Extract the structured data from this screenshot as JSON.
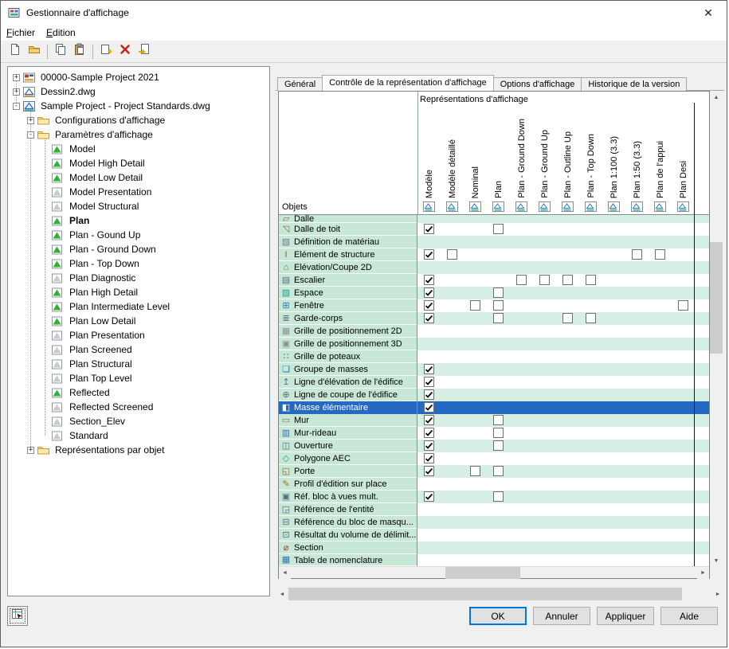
{
  "window": {
    "title": "Gestionnaire d'affichage",
    "close_glyph": "✕"
  },
  "menu": {
    "items": [
      "Fichier",
      "Edition"
    ]
  },
  "toolbar": {
    "buttons": [
      {
        "name": "new-button",
        "icon": "new-file-icon"
      },
      {
        "name": "open-button",
        "icon": "open-folder-icon"
      },
      {
        "name": "copy-button",
        "icon": "copy-icon"
      },
      {
        "name": "paste-button",
        "icon": "paste-icon"
      },
      {
        "name": "new-display-item-button",
        "icon": "new-item-icon"
      },
      {
        "name": "delete-button",
        "icon": "delete-red-x-icon"
      },
      {
        "name": "purge-button",
        "icon": "page-arrow-icon"
      }
    ]
  },
  "tree": {
    "items": [
      {
        "label": "00000-Sample Project 2021",
        "depth": 0,
        "expander": "plus",
        "icon": "project-icon"
      },
      {
        "label": "Dessin2.dwg",
        "depth": 0,
        "expander": "plus",
        "icon": "drawing-icon"
      },
      {
        "label": "Sample Project - Project Standards.dwg",
        "depth": 0,
        "expander": "minus",
        "icon": "drawing-standards-icon"
      },
      {
        "label": "Configurations d'affichage",
        "depth": 1,
        "expander": "plus",
        "icon": "folder-icon"
      },
      {
        "label": "Paramètres d'affichage",
        "depth": 1,
        "expander": "minus",
        "icon": "folder-icon"
      },
      {
        "label": "Model",
        "depth": 2,
        "icon": "display-set-icon",
        "in_use": true
      },
      {
        "label": "Model High Detail",
        "depth": 2,
        "icon": "display-set-icon",
        "in_use": true
      },
      {
        "label": "Model Low Detail",
        "depth": 2,
        "icon": "display-set-icon",
        "in_use": true
      },
      {
        "label": "Model Presentation",
        "depth": 2,
        "icon": "display-set-icon",
        "in_use": false
      },
      {
        "label": "Model Structural",
        "depth": 2,
        "icon": "display-set-icon",
        "in_use": false
      },
      {
        "label": "Plan",
        "depth": 2,
        "icon": "display-set-icon",
        "in_use": true,
        "bold": true
      },
      {
        "label": "Plan - Gound Up",
        "depth": 2,
        "icon": "display-set-icon",
        "in_use": true
      },
      {
        "label": "Plan - Ground Down",
        "depth": 2,
        "icon": "display-set-icon",
        "in_use": true
      },
      {
        "label": "Plan - Top Down",
        "depth": 2,
        "icon": "display-set-icon",
        "in_use": true
      },
      {
        "label": "Plan Diagnostic",
        "depth": 2,
        "icon": "display-set-icon",
        "in_use": false
      },
      {
        "label": "Plan High Detail",
        "depth": 2,
        "icon": "display-set-icon",
        "in_use": true
      },
      {
        "label": "Plan Intermediate Level",
        "depth": 2,
        "icon": "display-set-icon",
        "in_use": true
      },
      {
        "label": "Plan Low Detail",
        "depth": 2,
        "icon": "display-set-icon",
        "in_use": true
      },
      {
        "label": "Plan Presentation",
        "depth": 2,
        "icon": "display-set-icon",
        "in_use": false
      },
      {
        "label": "Plan Screened",
        "depth": 2,
        "icon": "display-set-icon",
        "in_use": false
      },
      {
        "label": "Plan Structural",
        "depth": 2,
        "icon": "display-set-icon",
        "in_use": false
      },
      {
        "label": "Plan Top Level",
        "depth": 2,
        "icon": "display-set-icon",
        "in_use": false
      },
      {
        "label": "Reflected",
        "depth": 2,
        "icon": "display-set-icon",
        "in_use": true
      },
      {
        "label": "Reflected Screened",
        "depth": 2,
        "icon": "display-set-icon",
        "in_use": false
      },
      {
        "label": "Section_Elev",
        "depth": 2,
        "icon": "display-set-icon",
        "in_use": false
      },
      {
        "label": "Standard",
        "depth": 2,
        "icon": "display-set-icon",
        "in_use": false
      },
      {
        "label": "Représentations par objet",
        "depth": 1,
        "expander": "plus",
        "icon": "folder-icon"
      }
    ]
  },
  "tabs": {
    "labels": [
      "Général",
      "Contrôle de la représentation d'affichage",
      "Options d'affichage",
      "Historique de la version"
    ],
    "active_index": 1
  },
  "grid": {
    "header_title": "Représentations d'affichage",
    "objects_label": "Objets",
    "columns": [
      "Modèle",
      "Modèle détaillé",
      "Nominal",
      "Plan",
      "Plan - Ground Down",
      "Plan - Ground Up",
      "Plan - Outline Up",
      "Plan - Top Down",
      "Plan 1:100 (3.3)",
      "Plan 1:50 (3.3)",
      "Plan de l'appui",
      "Plan Desi"
    ],
    "rows": [
      {
        "label": "Dalle",
        "icon": "slab-icon",
        "partial": "top",
        "cells": [
          "",
          "",
          "",
          "",
          "",
          "",
          "",
          "",
          "",
          "",
          "",
          ""
        ]
      },
      {
        "label": "Dalle de toit",
        "icon": "roof-slab-icon",
        "cells": [
          "c",
          "",
          "",
          "u",
          "",
          "",
          "",
          "",
          "",
          "",
          "",
          ""
        ]
      },
      {
        "label": "Définition de matériau",
        "icon": "material-definition-icon",
        "cells": [
          "",
          "",
          "",
          "",
          "",
          "",
          "",
          "",
          "",
          "",
          "",
          ""
        ]
      },
      {
        "label": "Elément de structure",
        "icon": "structural-member-icon",
        "cells": [
          "c",
          "u",
          "",
          "",
          "",
          "",
          "",
          "",
          "",
          "u",
          "u",
          ""
        ]
      },
      {
        "label": "Elévation/Coupe 2D",
        "icon": "elevation-section-2d-icon",
        "cells": [
          "",
          "",
          "",
          "",
          "",
          "",
          "",
          "",
          "",
          "",
          "",
          ""
        ]
      },
      {
        "label": "Escalier",
        "icon": "stair-icon",
        "cells": [
          "c",
          "",
          "",
          "",
          "u",
          "u",
          "u",
          "u",
          "",
          "",
          "",
          ""
        ]
      },
      {
        "label": "Espace",
        "icon": "space-icon",
        "cells": [
          "c",
          "",
          "",
          "u",
          "",
          "",
          "",
          "",
          "",
          "",
          "",
          ""
        ]
      },
      {
        "label": "Fenêtre",
        "icon": "window-icon",
        "cells": [
          "c",
          "",
          "u",
          "u",
          "",
          "",
          "",
          "",
          "",
          "",
          "",
          "u"
        ]
      },
      {
        "label": "Garde-corps",
        "icon": "railing-icon",
        "cells": [
          "c",
          "",
          "",
          "u",
          "",
          "",
          "u",
          "u",
          "",
          "",
          "",
          ""
        ]
      },
      {
        "label": "Grille de positionnement 2D",
        "icon": "layout-grid-2d-icon",
        "cells": [
          "",
          "",
          "",
          "",
          "",
          "",
          "",
          "",
          "",
          "",
          "",
          ""
        ]
      },
      {
        "label": "Grille de positionnement 3D",
        "icon": "layout-grid-3d-icon",
        "cells": [
          "",
          "",
          "",
          "",
          "",
          "",
          "",
          "",
          "",
          "",
          "",
          ""
        ]
      },
      {
        "label": "Grille de poteaux",
        "icon": "column-grid-icon",
        "cells": [
          "",
          "",
          "",
          "",
          "",
          "",
          "",
          "",
          "",
          "",
          "",
          ""
        ]
      },
      {
        "label": "Groupe de masses",
        "icon": "mass-group-icon",
        "cells": [
          "c",
          "",
          "",
          "",
          "",
          "",
          "",
          "",
          "",
          "",
          "",
          ""
        ]
      },
      {
        "label": "Ligne d'élévation de l'édifice",
        "icon": "building-elevation-line-icon",
        "cells": [
          "c",
          "",
          "",
          "",
          "",
          "",
          "",
          "",
          "",
          "",
          "",
          ""
        ]
      },
      {
        "label": "Ligne de coupe de l'édifice",
        "icon": "building-section-line-icon",
        "cells": [
          "c",
          "",
          "",
          "",
          "",
          "",
          "",
          "",
          "",
          "",
          "",
          ""
        ]
      },
      {
        "label": "Masse élémentaire",
        "icon": "mass-element-icon",
        "selected": true,
        "cells": [
          "c",
          "",
          "",
          "",
          "",
          "",
          "",
          "",
          "",
          "",
          "",
          ""
        ]
      },
      {
        "label": "Mur",
        "icon": "wall-icon",
        "cells": [
          "c",
          "",
          "",
          "u",
          "",
          "",
          "",
          "",
          "",
          "",
          "",
          ""
        ]
      },
      {
        "label": "Mur-rideau",
        "icon": "curtain-wall-icon",
        "cells": [
          "c",
          "",
          "",
          "u",
          "",
          "",
          "",
          "",
          "",
          "",
          "",
          ""
        ]
      },
      {
        "label": "Ouverture",
        "icon": "opening-icon",
        "cells": [
          "c",
          "",
          "",
          "u",
          "",
          "",
          "",
          "",
          "",
          "",
          "",
          ""
        ]
      },
      {
        "label": "Polygone AEC",
        "icon": "aec-polygon-icon",
        "cells": [
          "c",
          "",
          "",
          "",
          "",
          "",
          "",
          "",
          "",
          "",
          "",
          ""
        ]
      },
      {
        "label": "Porte",
        "icon": "door-icon",
        "cells": [
          "c",
          "",
          "u",
          "u",
          "",
          "",
          "",
          "",
          "",
          "",
          "",
          ""
        ]
      },
      {
        "label": "Profil d'édition sur place",
        "icon": "edit-in-place-profile-icon",
        "cells": [
          "",
          "",
          "",
          "",
          "",
          "",
          "",
          "",
          "",
          "",
          "",
          ""
        ]
      },
      {
        "label": "Réf. bloc à vues mult.",
        "icon": "multi-view-block-icon",
        "cells": [
          "c",
          "",
          "",
          "u",
          "",
          "",
          "",
          "",
          "",
          "",
          "",
          ""
        ]
      },
      {
        "label": "Référence de l'entité",
        "icon": "entity-reference-icon",
        "cells": [
          "",
          "",
          "",
          "",
          "",
          "",
          "",
          "",
          "",
          "",
          "",
          ""
        ]
      },
      {
        "label": "Référence du bloc de masqu...",
        "icon": "mask-block-icon",
        "cells": [
          "",
          "",
          "",
          "",
          "",
          "",
          "",
          "",
          "",
          "",
          "",
          ""
        ]
      },
      {
        "label": "Résultat du volume de délimit...",
        "icon": "bounded-volume-icon",
        "cells": [
          "",
          "",
          "",
          "",
          "",
          "",
          "",
          "",
          "",
          "",
          "",
          ""
        ]
      },
      {
        "label": "Section",
        "icon": "section-icon",
        "cells": [
          "",
          "",
          "",
          "",
          "",
          "",
          "",
          "",
          "",
          "",
          "",
          ""
        ]
      },
      {
        "label": "Table de nomenclature",
        "icon": "schedule-table-icon",
        "partial": "bottom",
        "cells": [
          "",
          "",
          "",
          "",
          "",
          "",
          "",
          "",
          "",
          "",
          "",
          ""
        ]
      }
    ]
  },
  "footer": {
    "ok": "OK",
    "cancel": "Annuler",
    "apply": "Appliquer",
    "help": "Aide"
  },
  "colors": {
    "selection_blue": "#2569c3",
    "row_green": "#d6efe3",
    "name_cell_green": "#c8e8d7",
    "in_use_green": "#2eb135",
    "delete_red": "#cc2222"
  }
}
